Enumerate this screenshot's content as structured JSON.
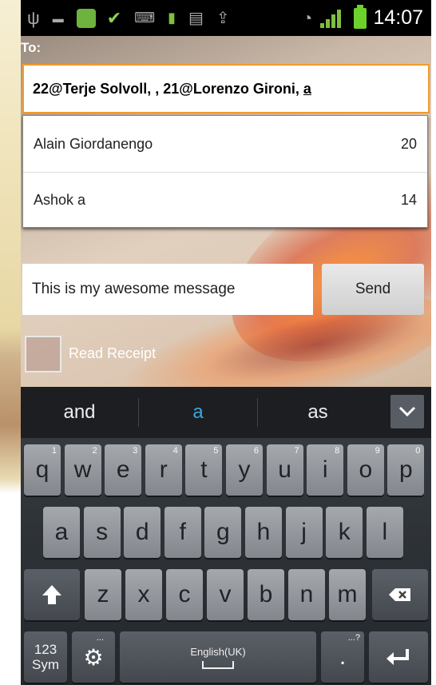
{
  "status_bar": {
    "time": "14:07",
    "icons": [
      "usb-icon",
      "notification-icon",
      "check-icon",
      "keyboard-icon",
      "battery-full-icon",
      "sd-card-icon",
      "upload-icon",
      "wifi-icon",
      "signal-icon",
      "battery-icon"
    ]
  },
  "compose": {
    "to_label": "To:",
    "to_value": "22@Terje Solvoll, , 21@Lorenzo Gironi, ",
    "to_typed": "a",
    "suggestions": [
      {
        "name": "Alain Giordanengo",
        "count": "20"
      },
      {
        "name": "Ashok a",
        "count": "14"
      }
    ],
    "message": "This is my awesome message",
    "send_label": "Send",
    "read_receipt_label": "Read Receipt",
    "read_receipt_checked": false
  },
  "keyboard": {
    "suggestions": [
      "and",
      "a",
      "as"
    ],
    "selected_suggestion": "a",
    "accent_color": "#3aa6e0",
    "row1": [
      {
        "k": "q",
        "h": "1"
      },
      {
        "k": "w",
        "h": "2"
      },
      {
        "k": "e",
        "h": "3"
      },
      {
        "k": "r",
        "h": "4"
      },
      {
        "k": "t",
        "h": "5"
      },
      {
        "k": "y",
        "h": "6"
      },
      {
        "k": "u",
        "h": "7"
      },
      {
        "k": "i",
        "h": "8"
      },
      {
        "k": "o",
        "h": "9"
      },
      {
        "k": "p",
        "h": "0"
      }
    ],
    "row2": [
      "a",
      "s",
      "d",
      "f",
      "g",
      "h",
      "j",
      "k",
      "l"
    ],
    "row3": [
      "z",
      "x",
      "c",
      "v",
      "b",
      "n",
      "m"
    ],
    "sym_top": "123",
    "sym_bottom": "Sym",
    "space_label": "English(UK)",
    "period_label": ".",
    "period_hint": "...?"
  }
}
